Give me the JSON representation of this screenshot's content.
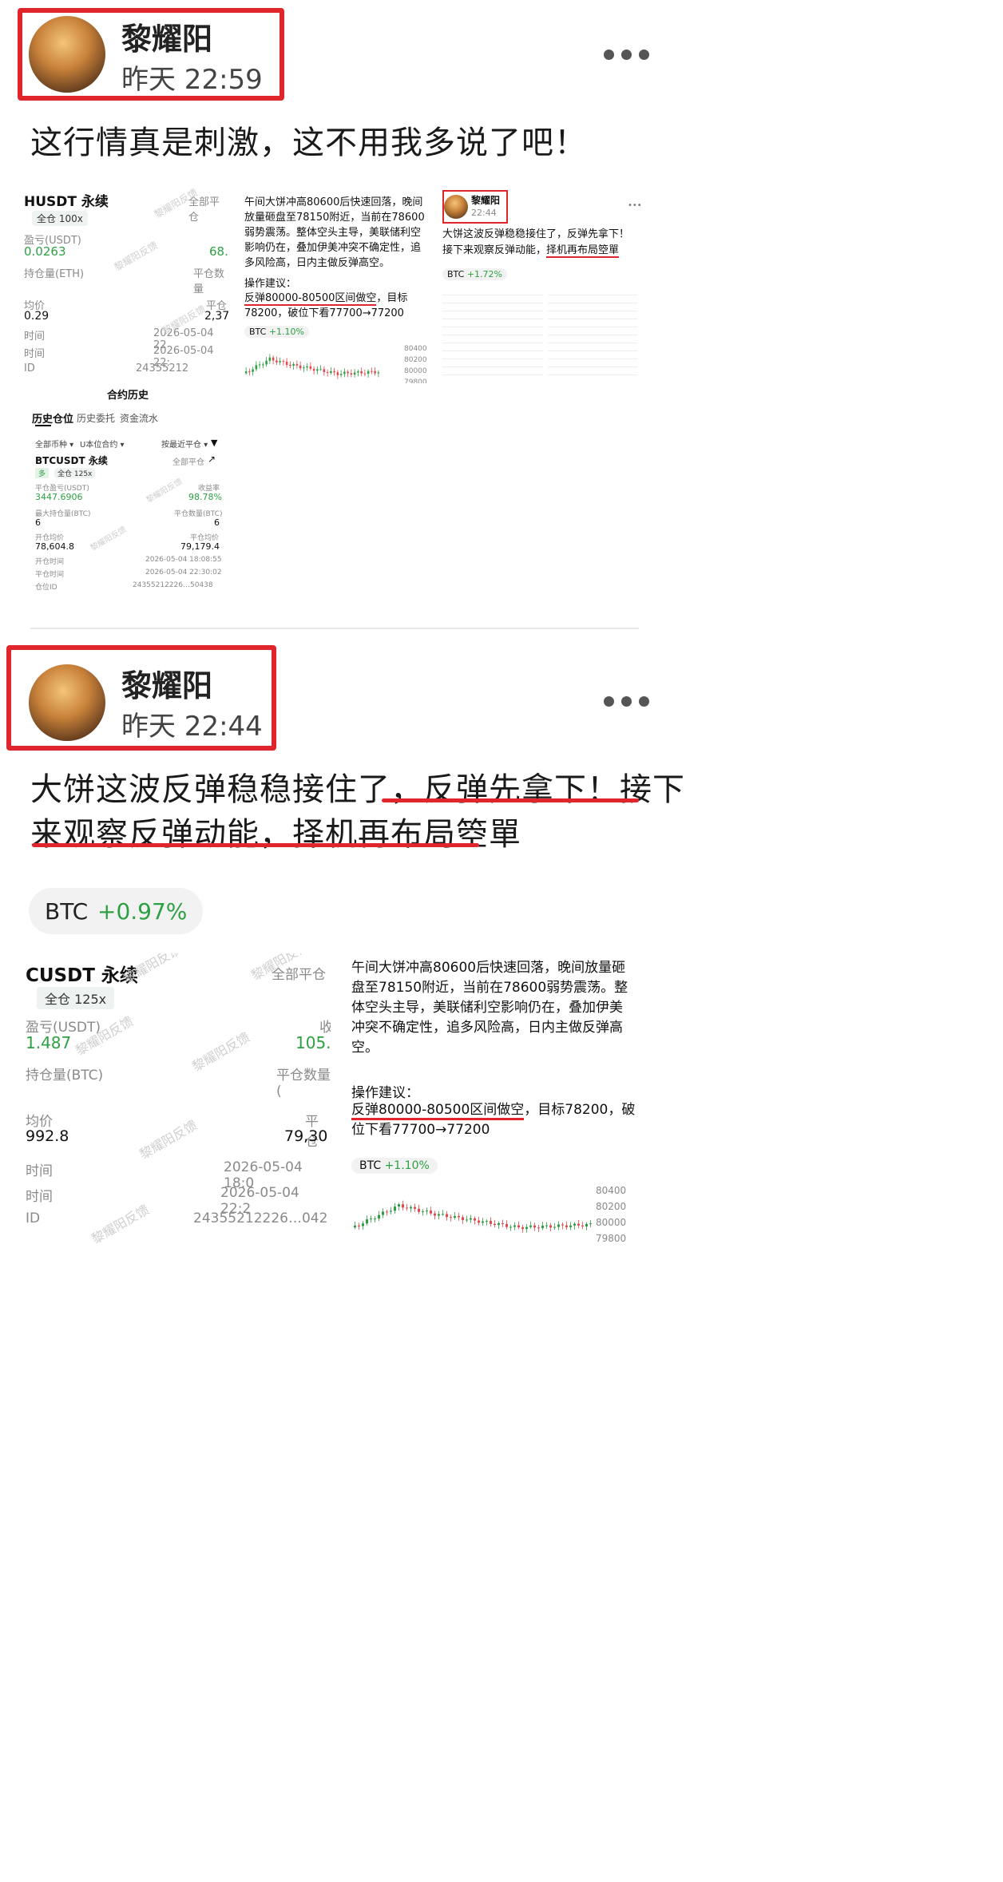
{
  "posts": [
    {
      "author": "黎耀阳",
      "time": "昨天 22:59",
      "text": "这行情真是刺激，这不用我多说了吧！",
      "shot1": {
        "title": "HUSDT 永续",
        "filter": "全部平仓",
        "margin": "全仓 100x",
        "pnl_label": "盈亏(USDT)",
        "pnl_value": "0.0263",
        "right_value": "68.",
        "hold_label": "持仓量(ETH)",
        "close_qty_label": "平仓数量",
        "avg_label": "均价",
        "avg_value": "0.29",
        "close_avg_label": "平仓",
        "close_avg_value": "2,37",
        "open_time_label": "时间",
        "open_time_value": "2026-05-04 22",
        "close_time_label": "时间",
        "close_time_value": "2026-05-04 22:",
        "id_label": "ID",
        "id_value": "24355212"
      },
      "shot2": {
        "header_title": "合约历史",
        "tabs": [
          "历史仓位",
          "历史委托",
          "资金流水"
        ],
        "filter_all": "全部币种",
        "filter_unit": "U本位合约",
        "filter_sort": "按最近平仓",
        "title": "BTCUSDT 永续",
        "filter": "全部平仓",
        "side": "多",
        "margin": "全仓 125x",
        "pnl_label": "平仓盈亏(USDT)",
        "pnl_value": "3447.6906",
        "yield_label": "收益率",
        "yield_value": "98.78%",
        "max_hold_label": "最大持仓量(BTC)",
        "max_hold_value": "6",
        "close_qty_label": "平仓数量(BTC)",
        "close_qty_value": "6",
        "open_avg_label": "开仓均价",
        "open_avg_value": "78,604.8",
        "close_avg_label": "平仓均价",
        "close_avg_value": "79,179.4",
        "open_time_label": "开仓时间",
        "open_time_value": "2026-05-04 18:08:55",
        "close_time_label": "平仓时间",
        "close_time_value": "2026-05-04 22:30:02",
        "id_label": "仓位ID",
        "id_value": "24355212226",
        "id_tail": "50438"
      },
      "shot3": {
        "para": "午间大饼冲高80600后快速回落，晚间放量砸盘至78150附近，当前在78600弱势震荡。整体空头主导，美联储利空影响仍在，叠加伊美冲突不确定性，追多风险高，日内主做反弹高空。",
        "advice_label": "操作建议：",
        "advice_hl": "反弹80000-80500区间做空",
        "advice_rest": "，目标78200，破位下看77700→77200",
        "tag_name": "BTC",
        "tag_change": "+1.10%",
        "y_ticks": [
          "80400",
          "80200",
          "80000",
          "79800"
        ]
      },
      "shot4": {
        "author": "黎耀阳",
        "time": "22:44",
        "text_a": "大饼这波反弹稳稳接住了，反弹先拿下！接下来观察反弹动能，",
        "text_hl": "择机再布局箜單",
        "tag_name": "BTC",
        "tag_change": "+1.72%"
      }
    },
    {
      "author": "黎耀阳",
      "time": "昨天 22:44",
      "line1_a": "大饼这波反弹稳稳接住了，",
      "line1_b": "反弹先拿下！接下",
      "line2_a": "来观察反弹动能，择机再布局箜單",
      "tag_name": "BTC",
      "tag_change": "+0.97%",
      "shot1": {
        "title": "CUSDT 永续",
        "filter": "全部平仓",
        "margin": "全仓 125x",
        "pnl_label": "盈亏(USDT)",
        "pnl_value": "1.487",
        "yield_label": "收",
        "yield_value": "105.0",
        "hold_label": "持仓量(BTC)",
        "close_qty_label": "平仓数量(",
        "avg_label": "均价",
        "avg_value": "992.8",
        "close_avg_label": "平仓",
        "close_avg_value": "79,30",
        "open_time_label": "时间",
        "open_time_value": "2026-05-04 18:0",
        "close_time_label": "时间",
        "close_time_value": "2026-05-04 22:2",
        "id_label": "ID",
        "id_value": "24355212226",
        "id_tail": "042"
      },
      "shot2": {
        "para": "午间大饼冲高80600后快速回落，晚间放量砸盘至78150附近，当前在78600弱势震荡。整体空头主导，美联储利空影响仍在，叠加伊美冲突不确定性，追多风险高，日内主做反弹高空。",
        "advice_label": "操作建议：",
        "advice_hl": "反弹80000-80500区间做空",
        "advice_rest": "，目标78200，破位下看77700→77200",
        "tag_name": "BTC",
        "tag_change": "+1.10%",
        "y_ticks": [
          "80400",
          "80200",
          "80000",
          "79800"
        ]
      }
    }
  ],
  "watermark": "黎耀阳反馈",
  "colors": {
    "accent_red": "#e0252c",
    "up_green": "#2ea043",
    "down_red": "#e5484d"
  }
}
